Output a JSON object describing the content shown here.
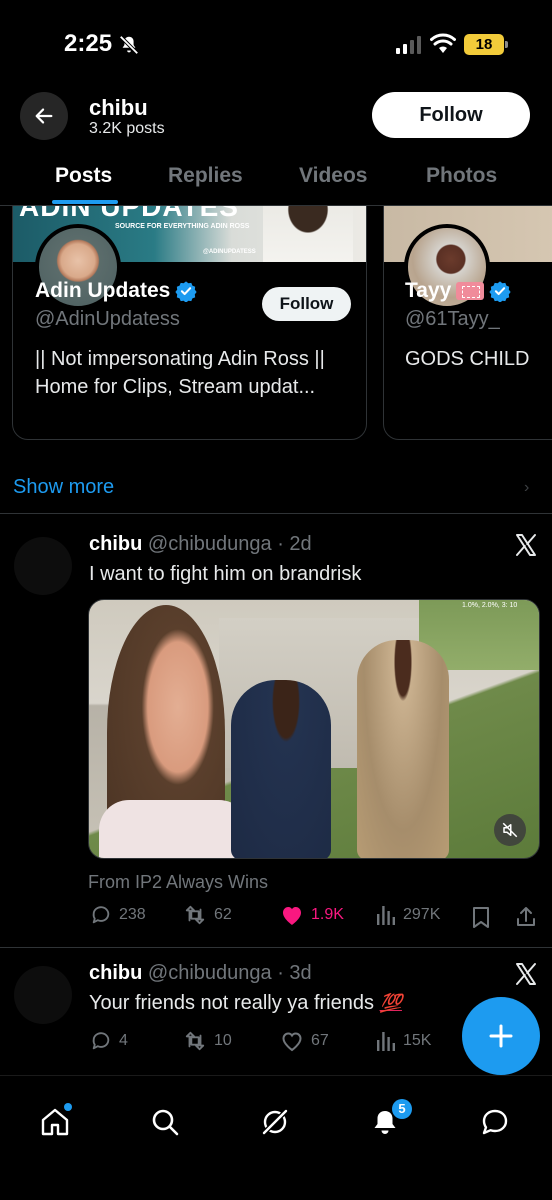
{
  "status_bar": {
    "time": "2:25",
    "battery": "18"
  },
  "header": {
    "name": "chibu",
    "posts_count": "3.2K posts",
    "follow_label": "Follow"
  },
  "tabs": [
    {
      "label": "Posts"
    },
    {
      "label": "Replies"
    },
    {
      "label": "Videos"
    },
    {
      "label": "Photos"
    }
  ],
  "suggestions": [
    {
      "name": "Adin Updates",
      "handle": "@AdinUpdatess",
      "bio_line1": "|| Not impersonating Adin Ross ||",
      "bio_line2": "Home for Clips, Stream updat...",
      "follow_label": "Follow",
      "banner_title": "ADIN UPDATES",
      "banner_sub": "SOURCE FOR EVERYTHING ADIN ROSS",
      "banner_handle": "@ADINUPDATESS"
    },
    {
      "name": "Tayy",
      "handle": "@61Tayy_",
      "bio_line1": "GODS CHILD"
    }
  ],
  "show_more": "Show more",
  "tweets": [
    {
      "name": "chibu",
      "meta": "@chibudunga · 2d",
      "text": "I want to fight him on brandrisk",
      "source": "From IP2 Always Wins",
      "media_watermark": "1.0%, 2.0%, 3: 10",
      "replies": "238",
      "reposts": "62",
      "likes": "1.9K",
      "views": "297K"
    },
    {
      "name": "chibu",
      "meta": "@chibudunga · 3d",
      "text": "Your friends not really ya friends",
      "emoji": "💯",
      "replies": "4",
      "reposts": "10",
      "likes": "67",
      "views": "15K"
    }
  ],
  "nav": {
    "notifications_badge": "5"
  },
  "colors": {
    "accent": "#1d9bf0",
    "like": "#f91880",
    "background": "#000000",
    "muted": "#71767b"
  }
}
